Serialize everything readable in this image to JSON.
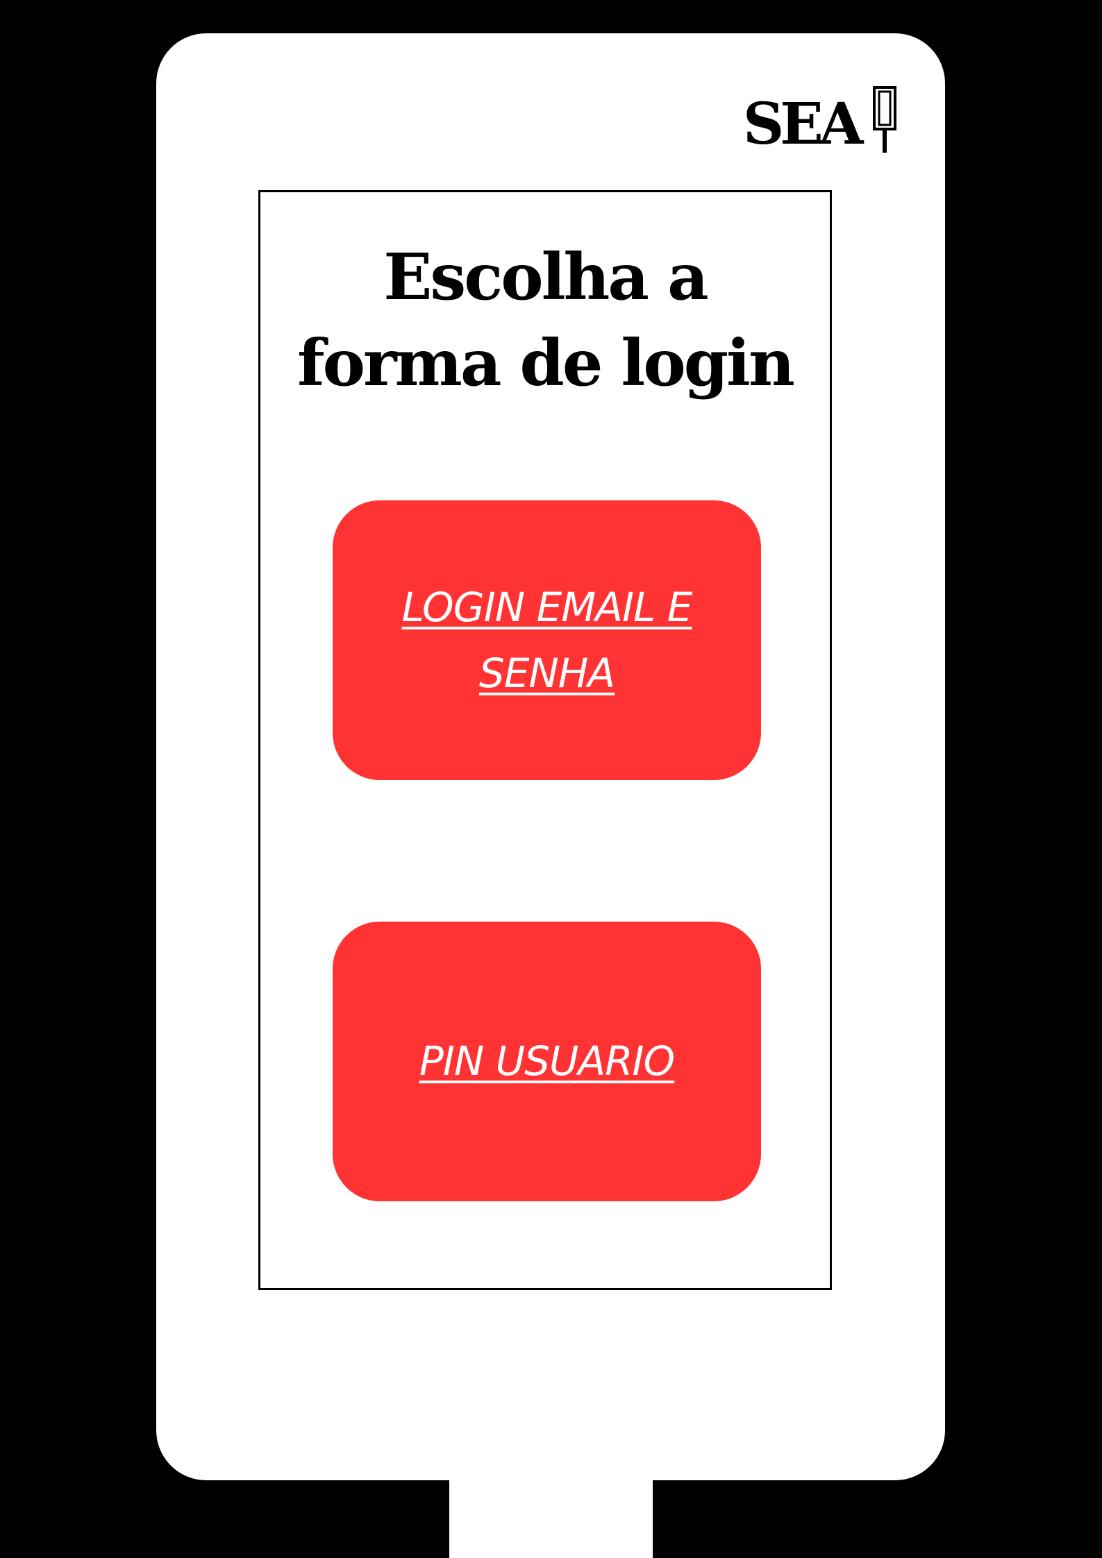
{
  "header": {
    "logo_text": "SEA"
  },
  "login_choice": {
    "title_line1": "Escolha a",
    "title_line2": "forma de login",
    "email_button_line1": "LOGIN EMAIL E",
    "email_button_line2": "SENHA",
    "pin_button_label": "PIN USUARIO"
  },
  "colors": {
    "background": "#000000",
    "device": "#ffffff",
    "button": "#ff3333",
    "button_text": "#ffffff"
  }
}
